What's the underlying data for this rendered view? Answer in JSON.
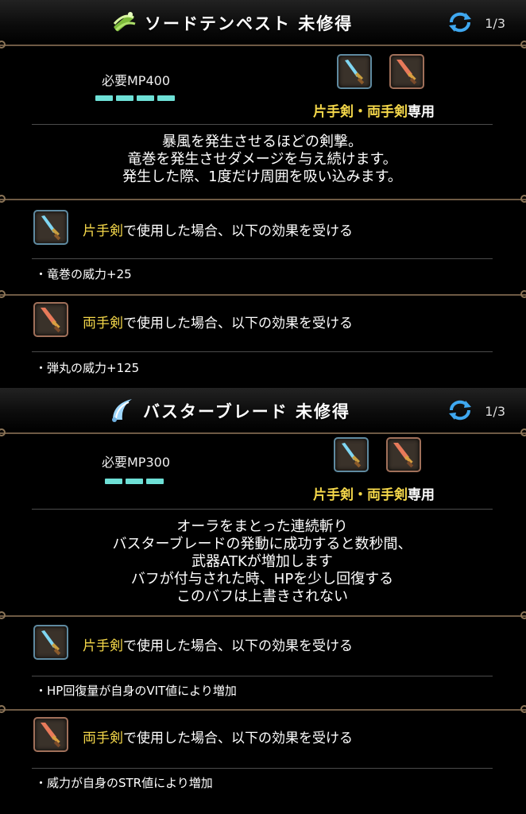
{
  "skills": [
    {
      "title": "ソードテンペスト 未修得",
      "page": "1/3",
      "mp": "必要MP400",
      "mp_pips": 4,
      "restriction": {
        "one": "片手剣",
        "sep": "・",
        "two": "両手剣",
        "suffix": "専用"
      },
      "description": [
        "暴風を発生させるほどの剣撃。",
        "竜巻を発生させダメージを与え続けます。",
        "発生した際、1度だけ周囲を吸い込みます。"
      ],
      "effects": [
        {
          "weapon": "片手剣",
          "text": "で使用した場合、以下の効果を受ける",
          "bullet": "・竜巻の威力+25",
          "icon": "one-handed-sword-icon"
        },
        {
          "weapon": "両手剣",
          "text": "で使用した場合、以下の効果を受ける",
          "bullet": "・弾丸の威力+125",
          "icon": "two-handed-sword-icon"
        }
      ],
      "icon": "wind-sword-skill-icon"
    },
    {
      "title": "バスターブレード 未修得",
      "page": "1/3",
      "mp": "必要MP300",
      "mp_pips": 3,
      "restriction": {
        "one": "片手剣",
        "sep": "・",
        "two": "両手剣",
        "suffix": "専用"
      },
      "description": [
        "オーラをまとった連続斬り",
        "バスターブレードの発動に成功すると数秒間、",
        "武器ATKが増加します",
        "バフが付与された時、HPを少し回復する",
        "このバフは上書きされない"
      ],
      "effects": [
        {
          "weapon": "片手剣",
          "text": "で使用した場合、以下の効果を受ける",
          "bullet": "・HP回復量が自身のVIT値により増加",
          "icon": "one-handed-sword-icon"
        },
        {
          "weapon": "両手剣",
          "text": "で使用した場合、以下の効果を受ける",
          "bullet": "・威力が自身のSTR値により増加",
          "icon": "two-handed-sword-icon"
        }
      ],
      "icon": "buster-blade-skill-icon"
    }
  ],
  "colors": {
    "accent_yellow": "#f5d84a",
    "mp_pip": "#6ee0d6",
    "rail": "#6e5a44"
  }
}
